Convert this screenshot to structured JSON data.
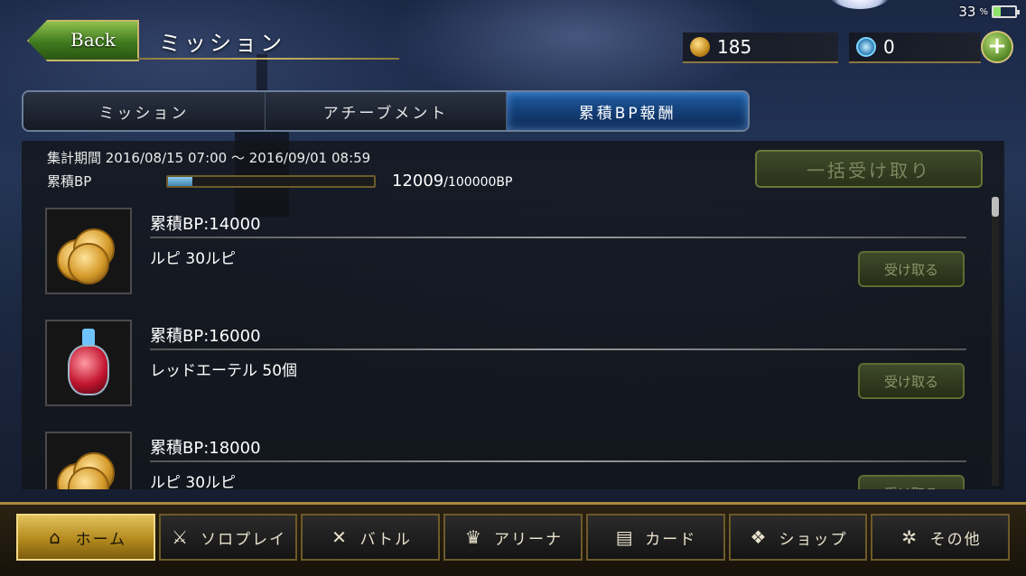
{
  "status": {
    "battery_percent": "33",
    "battery_unit": "%",
    "battery_level": 0.33
  },
  "header": {
    "back_label": "Back",
    "title": "ミッション",
    "gold": "185",
    "crystals": "0",
    "plus": "+"
  },
  "tabs": [
    {
      "label": "ミッション",
      "active": false
    },
    {
      "label": "アチーブメント",
      "active": false
    },
    {
      "label": "累積BP報酬",
      "active": true
    }
  ],
  "panel": {
    "period": "集計期間 2016/08/15 07:00 〜 2016/09/01 08:59",
    "bp_label": "累積BP",
    "bp_current": "12009",
    "bp_total": "/100000BP",
    "bp_fraction": 0.12009,
    "bulk_claim_label": "一括受け取り"
  },
  "rewards": [
    {
      "title": "累積BP:14000",
      "reward": "ルピ 30ルピ",
      "claim": "受け取る",
      "icon": "coins-icon"
    },
    {
      "title": "累積BP:16000",
      "reward": "レッドエーテル 50個",
      "claim": "受け取る",
      "icon": "potion-icon"
    },
    {
      "title": "累積BP:18000",
      "reward": "ルピ 30ルピ",
      "claim": "受け取る",
      "icon": "coins-icon"
    }
  ],
  "nav": [
    {
      "label": "ホーム",
      "icon": "home-icon",
      "glyph": "⌂",
      "active": true
    },
    {
      "label": "ソロプレイ",
      "icon": "sword-shield-icon",
      "glyph": "⚔",
      "active": false
    },
    {
      "label": "バトル",
      "icon": "crossed-swords-icon",
      "glyph": "✕",
      "active": false
    },
    {
      "label": "アリーナ",
      "icon": "arena-emblem-icon",
      "glyph": "♛",
      "active": false
    },
    {
      "label": "カード",
      "icon": "cards-icon",
      "glyph": "▤",
      "active": false
    },
    {
      "label": "ショップ",
      "icon": "shop-icon",
      "glyph": "❖",
      "active": false
    },
    {
      "label": "その他",
      "icon": "other-icon",
      "glyph": "✲",
      "active": false
    }
  ]
}
